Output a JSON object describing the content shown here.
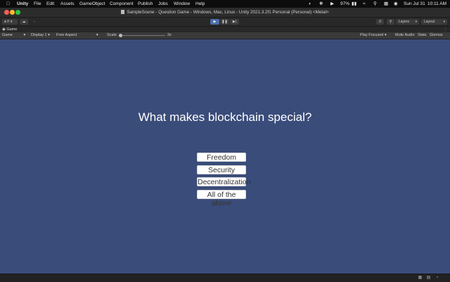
{
  "menubar": {
    "app": "Unity",
    "items": [
      "File",
      "Edit",
      "Assets",
      "GameObject",
      "Component",
      "Publish",
      "Jobs",
      "Window",
      "Help"
    ],
    "battery": "97%",
    "date": "Sun Jul 31",
    "time": "10:11 AM"
  },
  "window": {
    "title": "SampleScene - Question Game - Windows, Mac, Linux - Unity 2021.3.2f1 Personal (Personal) <Metal>"
  },
  "toolbar": {
    "account_label": "F",
    "layers_label": "Layers",
    "layout_label": "Layout"
  },
  "game_tab": {
    "label": "Game",
    "menu": "⋮"
  },
  "game_controls": {
    "view_mode": "Game",
    "display": "Display 1",
    "aspect": "Free Aspect",
    "scale_label": "Scale",
    "scale_value": "2x",
    "scale_level": 0,
    "play_mode": "Play Focused",
    "mute": "Mute Audio",
    "stats": "Stats",
    "gizmos": "Gizmos"
  },
  "game": {
    "question": "What makes blockchain special?",
    "answers": [
      "Freedom",
      "Security",
      "Decentralization",
      "All of the above"
    ]
  },
  "colors": {
    "game_background": "#3a4c7a",
    "close": "#ff5f57",
    "minimize": "#febc2e",
    "zoom": "#28c840"
  }
}
